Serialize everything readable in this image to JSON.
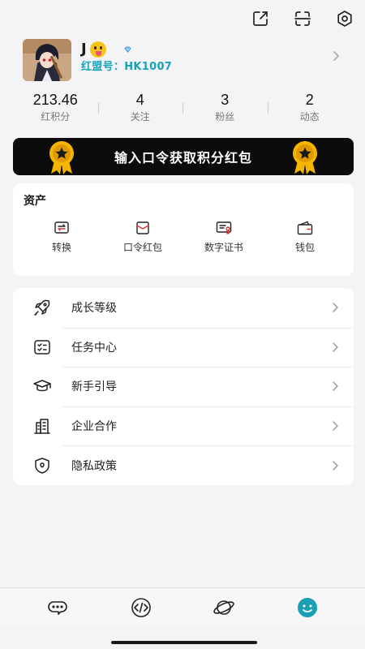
{
  "topbar": {
    "icons": [
      "share-icon",
      "scan-icon",
      "settings-icon"
    ]
  },
  "profile": {
    "name": "J",
    "emoji": "tongue-face-emoji",
    "id_label": "红盟号：",
    "id_value": "HK1007"
  },
  "stats": [
    {
      "value": "213.46",
      "label": "红积分"
    },
    {
      "value": "4",
      "label": "关注"
    },
    {
      "value": "3",
      "label": "粉丝"
    },
    {
      "value": "2",
      "label": "动态"
    }
  ],
  "banner": {
    "text": "输入口令获取积分红包"
  },
  "assets": {
    "title": "资产",
    "items": [
      {
        "label": "转换",
        "icon": "exchange-icon"
      },
      {
        "label": "口令红包",
        "icon": "red-envelope-icon"
      },
      {
        "label": "数字证书",
        "icon": "certificate-icon"
      },
      {
        "label": "钱包",
        "icon": "wallet-icon"
      }
    ]
  },
  "menu": [
    {
      "label": "成长等级",
      "icon": "rocket-icon"
    },
    {
      "label": "任务中心",
      "icon": "checklist-icon"
    },
    {
      "label": "新手引导",
      "icon": "graduation-cap-icon"
    },
    {
      "label": "企业合作",
      "icon": "building-icon"
    },
    {
      "label": "隐私政策",
      "icon": "shield-icon"
    }
  ],
  "tabbar": {
    "tabs": [
      "chat-icon",
      "code-icon",
      "planet-icon",
      "profile-smile-icon"
    ],
    "active_color": "#1a9fb5"
  },
  "colors": {
    "accent": "#17a2b8",
    "banner_bg": "#0c0c0c",
    "medal_gold": "#f4b400"
  }
}
